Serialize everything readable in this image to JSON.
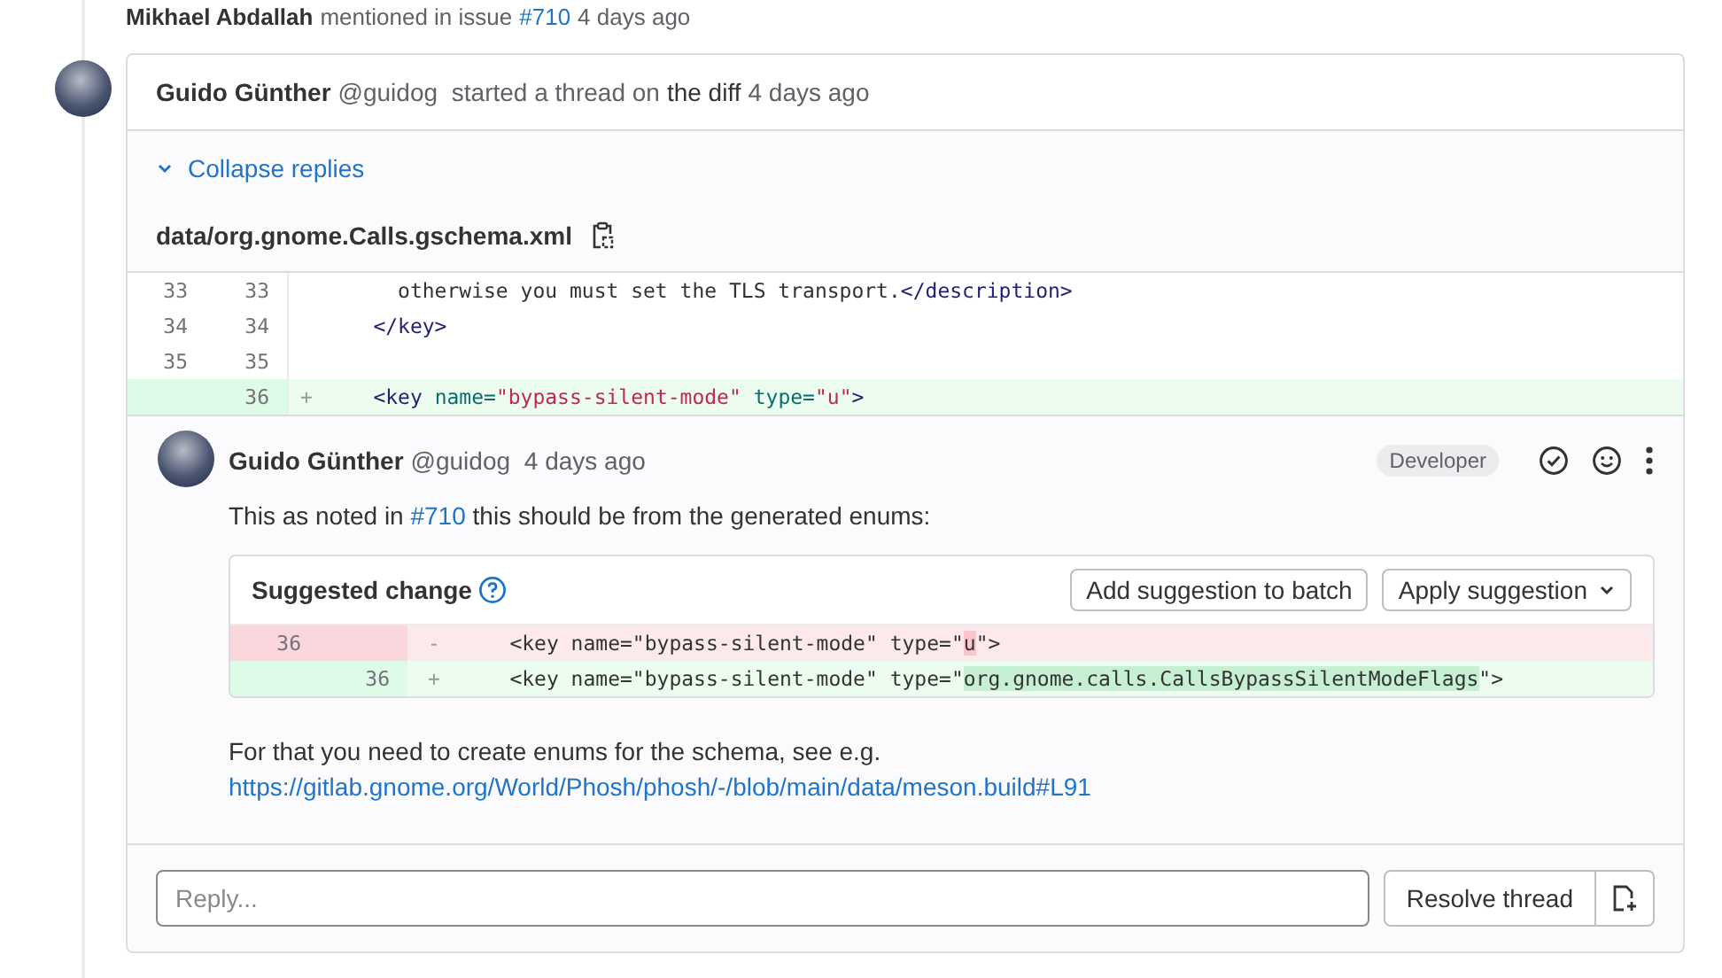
{
  "previous_event": {
    "author": "Mikhael Abdallah",
    "action": "mentioned in issue",
    "link": "#710",
    "time": "4 days ago"
  },
  "thread": {
    "author": "Guido Günther",
    "handle": "@guidog",
    "action": "started a thread on",
    "target": "the diff",
    "time": "4 days ago",
    "collapse_label": "Collapse replies",
    "file_path": "data/org.gnome.Calls.gschema.xml",
    "diff_lines": [
      {
        "old": "33",
        "new": "33",
        "kind": "context",
        "segments": [
          {
            "kind": "plain",
            "text": "      otherwise you must set the TLS transport."
          },
          {
            "kind": "tag",
            "text": "</description>"
          }
        ]
      },
      {
        "old": "34",
        "new": "34",
        "kind": "context",
        "segments": [
          {
            "kind": "tag",
            "text": "    </key>"
          }
        ]
      },
      {
        "old": "35",
        "new": "35",
        "kind": "context"
      },
      {
        "new": "36",
        "kind": "added",
        "sign": "+",
        "segments": [
          {
            "kind": "tag",
            "text": "    <key"
          },
          {
            "kind": "attr",
            "text": " name="
          },
          {
            "kind": "string",
            "text": "\"bypass-silent-mode\""
          },
          {
            "kind": "attr",
            "text": " type="
          },
          {
            "kind": "string",
            "text": "\"u\""
          },
          {
            "kind": "tag",
            "text": ">"
          }
        ]
      }
    ],
    "note": {
      "author": "Guido Günther",
      "handle": "@guidog",
      "time": "4 days ago",
      "role": "Developer",
      "body_before": "This as noted in",
      "body_link": "#710",
      "body_after": "this should be from the generated enums:",
      "suggestion": {
        "title": "Suggested change",
        "batch_button": "Add suggestion to batch",
        "apply_button": "Apply suggestion",
        "lines": [
          {
            "old": "36",
            "kind": "removed",
            "sign": "-",
            "segments": [
              {
                "kind": "plain",
                "text": "    <key name=\"bypass-silent-mode\" type=\""
              },
              {
                "kind": "removed-highlight",
                "text": "u"
              },
              {
                "kind": "plain",
                "text": "\">"
              }
            ]
          },
          {
            "new": "36",
            "kind": "added",
            "sign": "+",
            "segments": [
              {
                "kind": "plain",
                "text": "    <key name=\"bypass-silent-mode\" type=\""
              },
              {
                "kind": "added-highlight",
                "text": "org.gnome.calls.CallsBypassSilentModeFlags"
              },
              {
                "kind": "plain",
                "text": "\">"
              }
            ]
          }
        ]
      },
      "footer_text": "For that you need to create enums for the schema, see e.g.",
      "footer_link": "https://gitlab.gnome.org/World/Phosh/phosh/-/blob/main/data/meson.build#L91"
    },
    "reply": {
      "placeholder": "Reply...",
      "resolve_button": "Resolve thread"
    }
  }
}
